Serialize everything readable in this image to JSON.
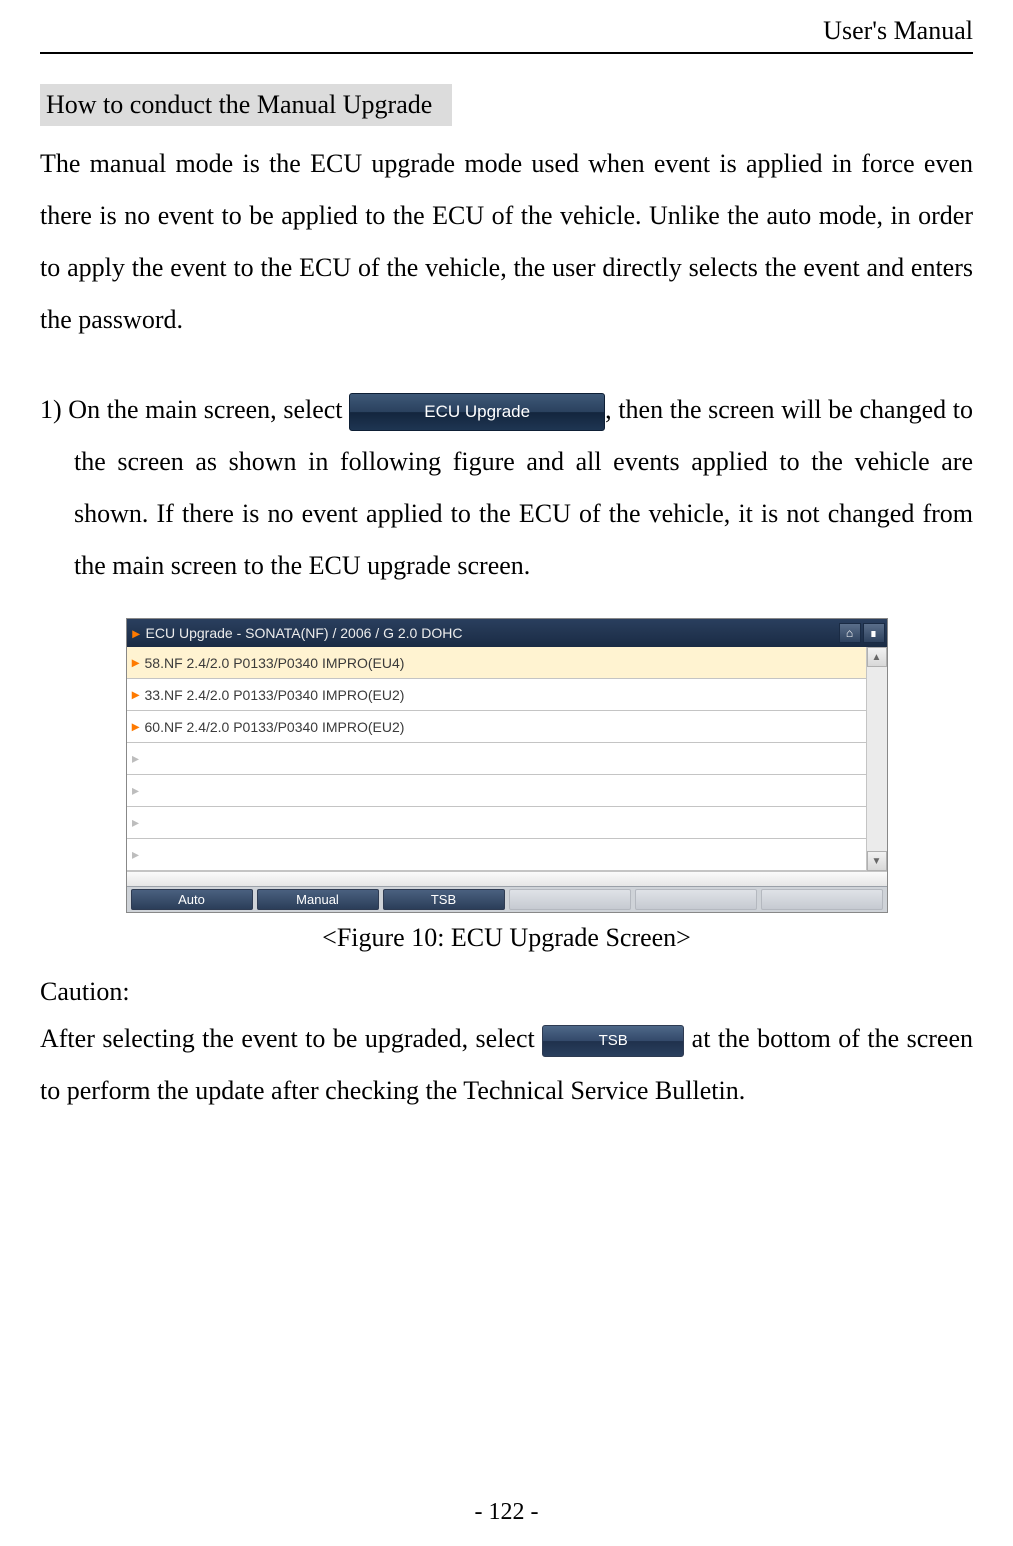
{
  "header": {
    "running_head": "User's Manual"
  },
  "section": {
    "heading": "How to conduct the Manual Upgrade"
  },
  "paragraphs": {
    "intro": "The manual mode is the ECU upgrade mode used when event is applied in force even there is no event to be applied to the ECU of the vehicle. Unlike the auto mode, in order to apply the event to the ECU of the vehicle, the user directly selects the event and enters the password.",
    "step1_pre": "1) On the main screen, select ",
    "step1_post": ", then the screen will be changed to the screen as shown in following figure and all events applied to the vehicle are shown. If there is no event applied to the ECU of the vehicle, it is not changed from the main screen to the ECU upgrade screen."
  },
  "buttons": {
    "ecu_upgrade_label": "ECU Upgrade",
    "tsb_label": "TSB"
  },
  "figure": {
    "caption": "<Figure 10: ECU Upgrade Screen>",
    "window_title": "ECU Upgrade - SONATA(NF) / 2006 / G 2.0 DOHC",
    "events": [
      "58.NF 2.4/2.0 P0133/P0340 IMPRO(EU4)",
      "33.NF 2.4/2.0 P0133/P0340 IMPRO(EU2)",
      "60.NF 2.4/2.0 P0133/P0340 IMPRO(EU2)"
    ],
    "tabs": {
      "auto": "Auto",
      "manual": "Manual",
      "tsb": "TSB"
    }
  },
  "caution": {
    "head": "Caution:",
    "pre": "After selecting the event to be upgraded, select ",
    "post": " at the bottom of the screen to perform the update after checking the Technical Service Bulletin."
  },
  "footer": {
    "page_number": "- 122 -"
  }
}
